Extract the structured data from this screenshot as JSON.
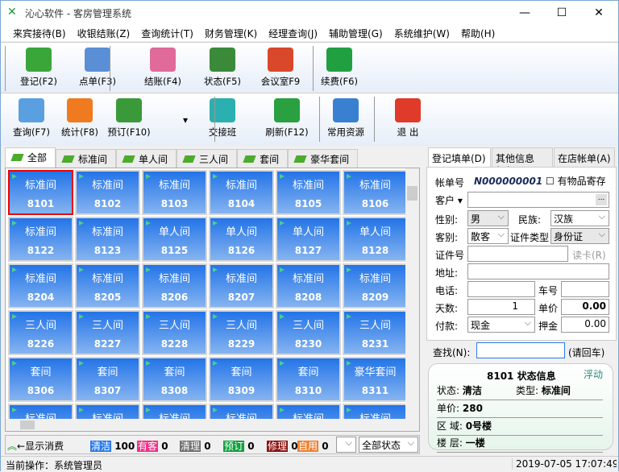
{
  "window": {
    "title": "沁心软件 - 客房管理系统",
    "minimize": "—",
    "maximize": "☐",
    "close": "✕"
  },
  "menu": [
    "来宾接待(B)",
    "收银结账(Z)",
    "查询统计(T)",
    "财务管理(K)",
    "经理查询(J)",
    "辅助管理(G)",
    "系统维护(W)",
    "帮助(H)"
  ],
  "toolbar1": [
    {
      "label": "登记(F2)",
      "icon": "register-icon",
      "color": "#3aa63a"
    },
    {
      "label": "点单(F3)",
      "icon": "order-icon",
      "color": "#5a8fd6"
    },
    {
      "label": "结账(F4)",
      "icon": "checkout-icon",
      "color": "#e06a9a"
    },
    {
      "label": "状态(F5)",
      "icon": "status-icon",
      "color": "#3a8a3a"
    },
    {
      "label": "会议室F9",
      "icon": "house-icon",
      "color": "#d9482b"
    },
    {
      "label": "续费(F6)",
      "icon": "dollar-icon",
      "color": "#20a040"
    }
  ],
  "toolbar2": [
    {
      "label": "查询(F7)",
      "icon": "search-icon",
      "color": "#5aa0e0"
    },
    {
      "label": "统计(F8)",
      "icon": "cubes-icon",
      "color": "#f07a20"
    },
    {
      "label": "预订(F10)",
      "icon": "folder-icon",
      "color": "#3a9a3a"
    },
    {
      "label": "交接班",
      "icon": "play-icon",
      "color": "#2ab0b0"
    },
    {
      "label": "刷新(F12)",
      "icon": "recycle-icon",
      "color": "#2aa040"
    },
    {
      "label": "常用资源",
      "icon": "resources-icon",
      "color": "#3a80d0"
    },
    {
      "label": "退  出",
      "icon": "power-icon",
      "color": "#e03a2a"
    }
  ],
  "room_tabs": [
    "全部",
    "标准间",
    "单人间",
    "三人间",
    "套间",
    "豪华套间"
  ],
  "rooms": [
    [
      "标准间",
      "8101"
    ],
    [
      "标准间",
      "8102"
    ],
    [
      "标准间",
      "8103"
    ],
    [
      "标准间",
      "8104"
    ],
    [
      "标准间",
      "8105"
    ],
    [
      "标准间",
      "8106"
    ],
    [
      "标准间",
      "8122"
    ],
    [
      "标准间",
      "8123"
    ],
    [
      "单人间",
      "8125"
    ],
    [
      "单人间",
      "8126"
    ],
    [
      "单人间",
      "8127"
    ],
    [
      "单人间",
      "8128"
    ],
    [
      "标准间",
      "8204"
    ],
    [
      "标准间",
      "8205"
    ],
    [
      "标准间",
      "8206"
    ],
    [
      "标准间",
      "8207"
    ],
    [
      "标准间",
      "8208"
    ],
    [
      "标准间",
      "8209"
    ],
    [
      "三人间",
      "8226"
    ],
    [
      "三人间",
      "8227"
    ],
    [
      "三人间",
      "8228"
    ],
    [
      "三人间",
      "8229"
    ],
    [
      "三人间",
      "8230"
    ],
    [
      "三人间",
      "8231"
    ],
    [
      "套间",
      "8306"
    ],
    [
      "套间",
      "8307"
    ],
    [
      "套间",
      "8308"
    ],
    [
      "套间",
      "8309"
    ],
    [
      "套间",
      "8310"
    ],
    [
      "豪华套间",
      "8311"
    ],
    [
      "标准间",
      ""
    ],
    [
      "标准间",
      ""
    ],
    [
      "标准间",
      ""
    ],
    [
      "标准间",
      ""
    ],
    [
      "标准间",
      ""
    ],
    [
      "标准间",
      ""
    ]
  ],
  "legend": {
    "show_consumption": "←显示消费",
    "items": [
      {
        "label": "清洁",
        "count": "100",
        "color": "#2a7ae8"
      },
      {
        "label": "有客",
        "count": "0",
        "color": "#f0308a"
      },
      {
        "label": "清理",
        "count": "0",
        "color": "#707070"
      },
      {
        "label": "预订",
        "count": "0",
        "color": "#10a040"
      },
      {
        "label": "修理",
        "count": "0",
        "color": "#8a1010"
      },
      {
        "label": "自用",
        "count": "0",
        "color": "#f08030"
      }
    ],
    "filter": "全部状态"
  },
  "status": {
    "operator": "当前操作：系统管理员",
    "datetime": "2019-07-05 17:07:49"
  },
  "right": {
    "tabs": [
      "登记填单(D)",
      "其他信息(Q)",
      "在店帐单(A)"
    ],
    "form": {
      "bill_no_label": "帐单号",
      "bill_no": "N000000001",
      "deposit_items": "有物品寄存",
      "customer": "客户",
      "gender_label": "性别:",
      "gender": "男",
      "ethnic_label": "民族:",
      "ethnic": "汉族",
      "guest_type_label": "客别:",
      "guest_type": "散客",
      "id_type_label": "证件类型",
      "id_type": "身份证",
      "id_no_label": "证件号",
      "read_card": "读卡(R)",
      "address_label": "地址:",
      "phone_label": "电话:",
      "car_label": "车号",
      "days_label": "天数:",
      "days": "1",
      "price_label": "单价",
      "price": "0.00",
      "pay_label": "付款:",
      "pay": "现金",
      "deposit_label": "押金",
      "deposit": "0.00",
      "more": "..."
    },
    "find_label": "查找(N):",
    "find_hint": "(请回车)",
    "info": {
      "title": "8101 状态信息",
      "float": "浮动",
      "state_label": "状态:",
      "state": "清洁",
      "type_label": "类型:",
      "type": "标准间",
      "price_label": "单价:",
      "price": "280",
      "area_label": "区    域:",
      "area": "0号楼",
      "floor_label": "楼    层:",
      "floor": "一楼"
    }
  }
}
